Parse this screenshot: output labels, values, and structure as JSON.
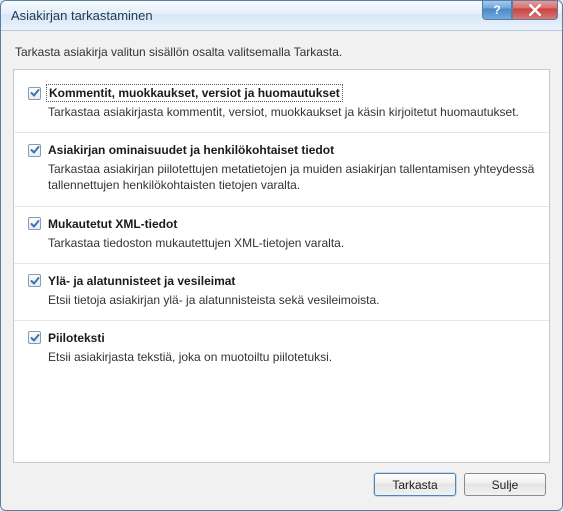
{
  "window": {
    "title": "Asiakirjan tarkastaminen",
    "help_symbol": "?",
    "close_label": "X"
  },
  "instruction": "Tarkasta asiakirja valitun sisällön osalta valitsemalla Tarkasta.",
  "options": [
    {
      "checked": true,
      "focused": true,
      "title": "Kommentit, muokkaukset, versiot ja huomautukset",
      "desc": "Tarkastaa asiakirjasta kommentit, versiot, muokkaukset ja käsin kirjoitetut huomautukset."
    },
    {
      "checked": true,
      "focused": false,
      "title": "Asiakirjan ominaisuudet ja henkilökohtaiset tiedot",
      "desc": "Tarkastaa asiakirjan piilotettujen metatietojen ja muiden asiakirjan tallentamisen yhteydessä tallennettujen henkilökohtaisten tietojen varalta."
    },
    {
      "checked": true,
      "focused": false,
      "title": "Mukautetut XML-tiedot",
      "desc": "Tarkastaa tiedoston mukautettujen XML-tietojen varalta."
    },
    {
      "checked": true,
      "focused": false,
      "title": "Ylä- ja alatunnisteet ja vesileimat",
      "desc": "Etsii tietoja asiakirjan ylä- ja alatunnisteista sekä vesileimoista."
    },
    {
      "checked": true,
      "focused": false,
      "title": "Piiloteksti",
      "desc": "Etsii asiakirjasta tekstiä, joka on muotoiltu piilotetuksi."
    }
  ],
  "buttons": {
    "inspect": "Tarkasta",
    "close": "Sulje"
  }
}
